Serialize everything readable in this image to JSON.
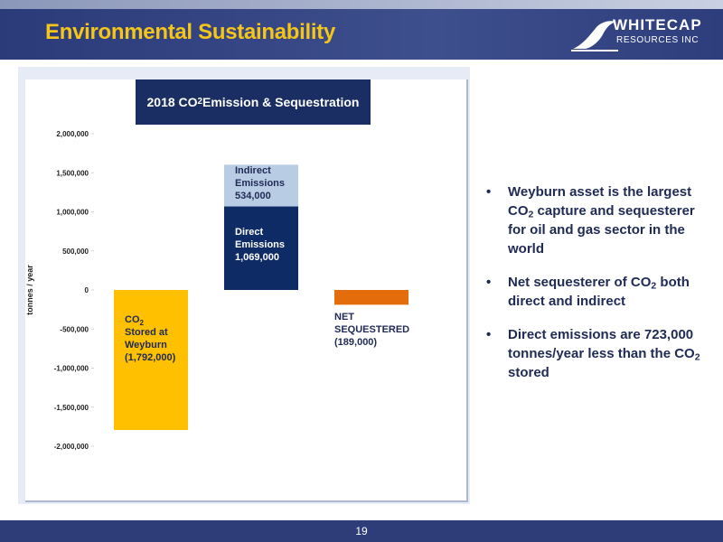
{
  "header": {
    "title": "Environmental Sustainability",
    "logo_main": "WHITECAP",
    "logo_sub": "RESOURCES INC"
  },
  "chart_data": {
    "type": "bar",
    "title_parts": [
      "2018 CO",
      "2",
      " Emission & Sequestration"
    ],
    "ylabel": "tonnes / year",
    "ylim": [
      -2000000,
      2000000
    ],
    "ticks": [
      "2,000,000",
      "1,500,000",
      "1,000,000",
      "500,000",
      "0",
      "-500,000",
      "-1,000,000",
      "-1,500,000",
      "-2,000,000"
    ],
    "bars": [
      {
        "category": "CO2 Stored at Weyburn",
        "base": 0,
        "value": -1792000,
        "color": "#ffc000",
        "label_lines": [
          [
            "CO",
            "2"
          ],
          [
            "Stored at"
          ],
          [
            "Weyburn"
          ],
          [
            "(1,792,000)"
          ]
        ]
      },
      {
        "category": "Direct Emissions",
        "base": 0,
        "value": 1069000,
        "color": "#0f2b66",
        "label_lines": [
          [
            "Direct"
          ],
          [
            "Emissions"
          ],
          [
            "1,069,000"
          ]
        ]
      },
      {
        "category": "Indirect Emissions",
        "base": 1069000,
        "value": 534000,
        "color": "#b8cce4",
        "label_lines": [
          [
            "Indirect"
          ],
          [
            "Emissions"
          ],
          [
            "534,000"
          ]
        ]
      },
      {
        "category": "Net Sequestered",
        "base": 0,
        "value": -189000,
        "color": "#e46c0a",
        "label_lines": [
          [
            "NET"
          ],
          [
            "SEQUESTERED"
          ],
          [
            "(189,000)"
          ]
        ]
      }
    ],
    "grid": false
  },
  "bullets": [
    {
      "parts": [
        "Weyburn asset is the largest CO",
        "2",
        " capture and sequesterer for oil and gas sector in the world"
      ]
    },
    {
      "parts": [
        "Net sequesterer of CO",
        "2",
        " both direct and indirect"
      ]
    },
    {
      "parts": [
        "Direct emissions are 723,000 tonnes/year less than the CO",
        "2",
        " stored"
      ]
    }
  ],
  "footer": {
    "page": "19"
  }
}
